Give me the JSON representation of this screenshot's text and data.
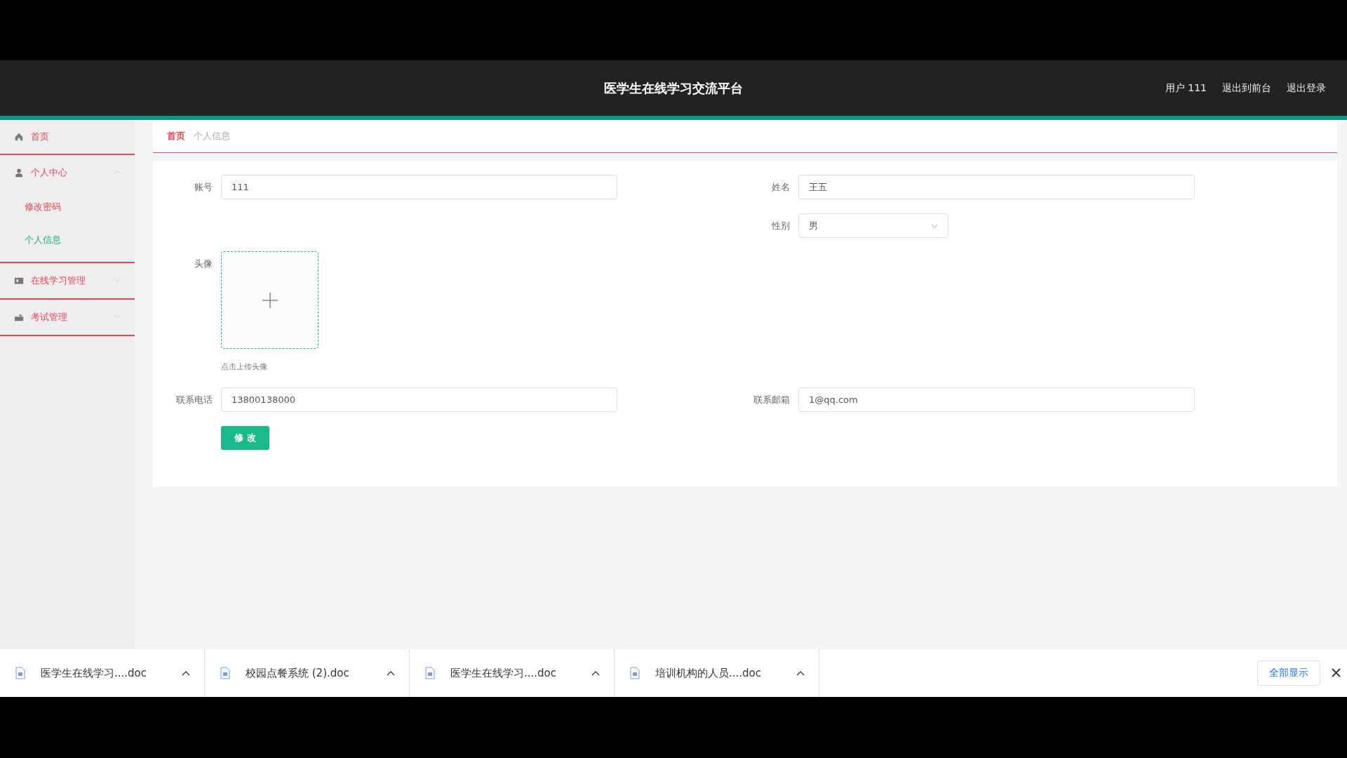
{
  "header": {
    "title": "医学生在线学习交流平台",
    "user": "用户 111",
    "links": [
      "退出到前台",
      "退出登录"
    ]
  },
  "sidebar": {
    "items": [
      {
        "kind": "link",
        "label": "首页"
      },
      {
        "kind": "group",
        "label": "个人中心",
        "expanded": true,
        "children": [
          {
            "label": "修改密码",
            "selected": false
          },
          {
            "label": "个人信息",
            "selected": true
          }
        ]
      },
      {
        "kind": "group",
        "label": "在线学习管理",
        "expanded": false
      },
      {
        "kind": "group",
        "label": "考试管理",
        "expanded": false
      }
    ]
  },
  "breadcrumb": [
    {
      "label": "首页",
      "current": false
    },
    {
      "label": "个人信息",
      "current": true
    }
  ],
  "form": {
    "account": {
      "label": "账号",
      "value": "111"
    },
    "name": {
      "label": "姓名",
      "value": "王五"
    },
    "gender": {
      "label": "性别",
      "value": "男"
    },
    "avatar": {
      "label": "头像",
      "hint": "点击上传头像"
    },
    "phone": {
      "label": "联系电话",
      "value": "13800138000"
    },
    "email": {
      "label": "联系邮箱",
      "value": "1@qq.com"
    },
    "submit": "修 改"
  },
  "downloads": {
    "items": [
      {
        "name": "医学生在线学习....doc"
      },
      {
        "name": "校园点餐系统 (2).doc"
      },
      {
        "name": "医学生在线学习....doc"
      },
      {
        "name": "培训机构的人员....doc"
      }
    ],
    "show_all": "全部显示"
  }
}
